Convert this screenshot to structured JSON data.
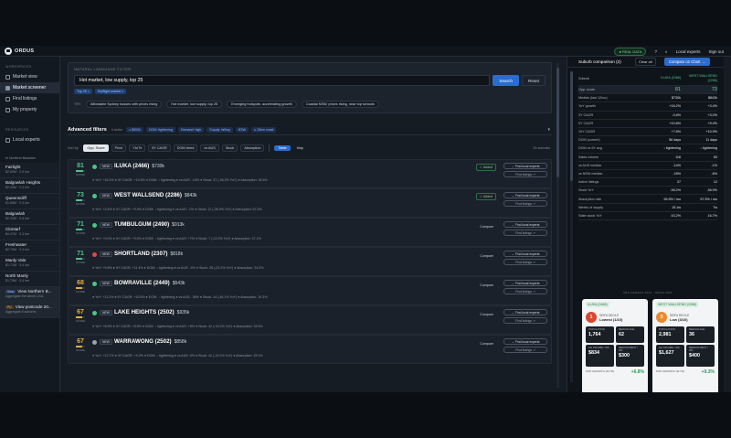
{
  "app": {
    "logo": "ORDUS",
    "live_badge": "● REAL DATA",
    "help": "?",
    "theme_icon": "◐",
    "local_experts": "Local experts",
    "sign_out": "Sign out"
  },
  "sidebar": {
    "workspaces_label": "WORKSPACES",
    "items": [
      {
        "label": "Market view"
      },
      {
        "label": "Market screener"
      },
      {
        "label": "Find listings"
      },
      {
        "label": "My property"
      }
    ],
    "resources_label": "RESOURCES",
    "local_experts": "Local experts",
    "region_label": "In Northern Beaches",
    "suburbs": [
      {
        "name": "Fairlight",
        "value": "$2.62M · 2.0 km"
      },
      {
        "name": "Balgowlah Heights",
        "value": "$2.49M · 2.4 km"
      },
      {
        "name": "Queenscliff",
        "value": "$1.65M · 2.3 km"
      },
      {
        "name": "Balgowlah",
        "value": "$2.33M · 2.6 km"
      },
      {
        "name": "Clontarf",
        "value": "$4.47M · 3.3 km"
      },
      {
        "name": "Freshwater",
        "value": "$2.70M · 3.4 km"
      },
      {
        "name": "Manly Vale",
        "value": "$1.71M · 3.4 km"
      },
      {
        "name": "North Manly",
        "value": "$1.79M · 3.4 km"
      },
      {
        "badge": "View",
        "name": "View Northern B...",
        "value": "Aggregate the whole LGA"
      },
      {
        "badge": "PC",
        "name": "View postcode 20...",
        "value": "Aggregate 8 suburbs"
      }
    ]
  },
  "filter": {
    "label": "NATURAL LANGUAGE FILTER",
    "query": "Hot market, low supply, top 25",
    "search_btn": "Search",
    "reset_btn": "Reset",
    "chips": [
      "Top 25 ×",
      "Hot/tight market ×"
    ],
    "try_label": "TRY:",
    "examples": [
      "Affordable Sydney houses with prices rising",
      "Hot market, low supply, top 25",
      "Emerging hotspots, accelerating growth",
      "Coastal NSW, prices rising, near top schools"
    ]
  },
  "advanced": {
    "title": "Advanced filters",
    "count": "4 active",
    "chips": [
      "≤ $500k",
      "DOM: tightening",
      "Demand: high",
      "Supply: falling",
      "NSW",
      "≤ 15km coast"
    ],
    "chevron": "▾"
  },
  "sort": {
    "label": "Sort by:",
    "options": [
      "Opp. Score",
      "Price",
      "Yld %",
      "5Y CAGR",
      "DOM trend",
      "vs AUS",
      "Stock",
      "Absorption"
    ],
    "views": [
      "Table",
      "Map"
    ],
    "count": "25 suburbs"
  },
  "rows": [
    {
      "score": "81",
      "name": "ILUKA (2466)",
      "price": "$730k",
      "color": "#4fc48a",
      "dot": "#4fc48a",
      "status": "added",
      "stats": "● YoY: +16.2%   ● 5Y CAGR: +10.8%   ● DOM: ↓ tightening   ● vs AUS: -14%   ● Stock: 37 (-36.2% YoY)   ● Absorption: 26.5%"
    },
    {
      "score": "73",
      "name": "WEST WALLSEND (2286)",
      "price": "$843k",
      "color": "#4fc48a",
      "dot": "#4fc48a",
      "status": "added",
      "stats": "● YoY: +3.4%   ● 5Y CAGR: +9.4%   ● DOM: ↓ tightening   ● vs AUS: -1%   ● Stock: 12 (-36.9% YoY)   ● Absorption: 57.5%"
    },
    {
      "score": "71",
      "name": "TUMBULGUM (2490)",
      "price": "$913k",
      "color": "#4fc48a",
      "dot": "#4fc48a",
      "status": "compare",
      "stats": "● YoY: +9.0%   ● 5Y CAGR: +9.0%   ● DOM: ↓ tightening   ● vs AUS: +7%   ● Stock: 7 (-22.2% YoY)   ● Absorption: 37.1%"
    },
    {
      "score": "71",
      "name": "SHORTLAND (2307)",
      "price": "$818k",
      "color": "#4fc48a",
      "dot": "#e04848",
      "status": "compare",
      "stats": "● YoY: +9.8%   ● 5Y CAGR: +11.4%   ● DOM: ↓ tightening   ● vs AUS: -4%   ● Stock: 28 (-22.2% YoY)   ● Absorption: 24.3%"
    },
    {
      "score": "68",
      "name": "BOWRAVILLE (2449)",
      "price": "$543k",
      "color": "#e0b040",
      "dot": "#4fc48a",
      "status": "compare",
      "stats": "● YoY: +11.3%   ● 5Y CAGR: +10.8%   ● DOM: ↓ tightening   ● vs AUS: -36%   ● Stock: 14 (-46.1% YoY)   ● Absorption: 19.3%"
    },
    {
      "score": "67",
      "name": "LAKE HEIGHTS (2502)",
      "price": "$935k",
      "color": "#e0b040",
      "dot": "#4fc48a",
      "status": "compare",
      "stats": "● YoY: +8.9%   ● 5Y CAGR: +8.5%   ● DOM: ↓ tightening   ● vs AUS: +8%   ● Stock: 42 (-19.2% YoY)   ● Absorption: 33.6%"
    },
    {
      "score": "67",
      "name": "WARRAWONG (2502)",
      "price": "$858k",
      "color": "#e0b040",
      "dot": "#9aa3af",
      "status": "compare",
      "stats": "● YoY: +12.7%   ● 5Y CAGR: +9.2%   ● DOM: ↓ tightening   ● vs AUS: 0%   ● Stock: 42 (-19.2% YoY)   ● Absorption: 15.2%"
    }
  ],
  "row_labels": {
    "new": "NEW",
    "added": "✓ Added",
    "compare": "Compare",
    "find_experts": "→ Find local experts",
    "find_listings": "Find listings ↗",
    "score_label": "SCORE"
  },
  "comparison": {
    "title": "Suburb comparison (2)",
    "clear": "Clear all",
    "cta": "Compare on Chart →",
    "suburb_label": "Suburb",
    "a_name": "ILUKA (2466)",
    "b_name": "WEST WALLSEND (2286)",
    "rows": [
      {
        "k": "Opp. score",
        "a": "81",
        "b": "73",
        "hl": true
      },
      {
        "k": "Median (last 12mo)",
        "a": "$730k",
        "b": "$843k"
      },
      {
        "k": "YoY growth",
        "a": "+16.2%",
        "b": "+3.4%"
      },
      {
        "k": "3Y CAGR",
        "a": "-0.6%",
        "b": "+3.2%"
      },
      {
        "k": "5Y CAGR",
        "a": "+10.8%",
        "b": "+9.4%"
      },
      {
        "k": "10Y CAGR",
        "a": "+7.8%",
        "b": "+10.9%"
      },
      {
        "k": "DOM (current)",
        "a": "56 days",
        "b": "11 days"
      },
      {
        "k": "DOM vs 5Y avg",
        "a": "↓ tightening",
        "b": "↓ tightening"
      },
      {
        "k": "Sales volume",
        "a": "118",
        "b": "83"
      },
      {
        "k": "vs AUS median",
        "a": "-14%",
        "b": "-1%"
      },
      {
        "k": "vs NSW median",
        "a": "-18%",
        "b": "-6%"
      },
      {
        "k": "Active listings",
        "a": "37",
        "b": "12"
      },
      {
        "k": "Stock YoY",
        "a": "-36.2%",
        "b": "-36.9%"
      },
      {
        "k": "Absorption rate",
        "a": "26.5% / mo",
        "b": "57.5% / mo"
      },
      {
        "k": "Weeks of supply",
        "a": "15.1w",
        "b": "7w"
      },
      {
        "k": "State stock YoY",
        "a": "43.2%",
        "b": "16.7%"
      }
    ],
    "census_label": "ABS CENSUS 2021 · SEIFA 2021",
    "cards": [
      {
        "name": "ILUKA (2466)",
        "seifa": "1",
        "seifa_color": "#d9452f",
        "seifa_title": "SEIFA DECILE",
        "seifa_val": "Lowest (1/10)",
        "tiles": [
          {
            "l": "POPULATION",
            "v": "1,764"
          },
          {
            "l": "MEDIAN AGE",
            "v": "62"
          },
          {
            "l": "HH INCOME / WK",
            "v": "$834"
          },
          {
            "l": "MEDIAN RENT / WK",
            "v": "$300"
          }
        ],
        "pop_label": "POP GROWTH (11YR)",
        "pop": "+6.8%"
      },
      {
        "name": "WEST WALLSEND (2286)",
        "seifa": "3",
        "seifa_color": "#ea8a2c",
        "seifa_title": "SEIFA DECILE",
        "seifa_val": "Low (3/10)",
        "tiles": [
          {
            "l": "POPULATION",
            "v": "2,981"
          },
          {
            "l": "MEDIAN AGE",
            "v": "36"
          },
          {
            "l": "HH INCOME / WK",
            "v": "$1,627"
          },
          {
            "l": "MEDIAN RENT / WK",
            "v": "$400"
          }
        ],
        "pop_label": "POP GROWTH (11YR)",
        "pop": "+9.3%"
      }
    ]
  }
}
